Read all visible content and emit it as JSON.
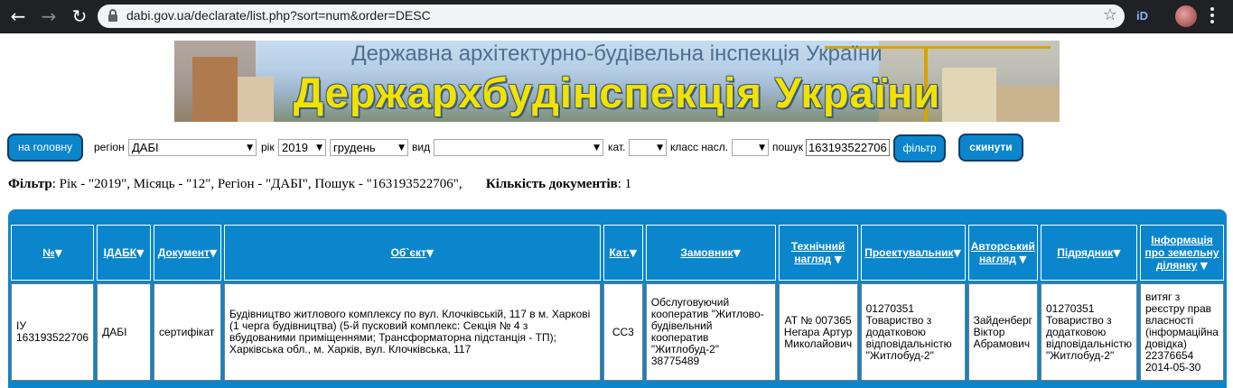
{
  "browser": {
    "url": "dabi.gov.ua/declarate/list.php?sort=num&order=DESC"
  },
  "banner": {
    "subtitle": "Державна архітектурно-будівельна інспекція України",
    "title": "Держархбудінспекція України"
  },
  "filters": {
    "home_button": "на головну",
    "region_label": "регіон",
    "region_value": "ДАБІ",
    "year_label": "рік",
    "year_value": "2019",
    "month_value": "грудень",
    "type_label": "вид",
    "type_value": "",
    "category_label": "кат.",
    "category_value": "",
    "class_label": "класс насл.",
    "class_value": "",
    "search_label": "пошук",
    "search_value": "163193522706",
    "filter_button": "фільтр",
    "reset_button": "скинути"
  },
  "summary": {
    "filter_label": "Фільтр",
    "filter_text": ": Рік - \"2019\", Місяць - \"12\", Регіон - \"ДАБІ\", Пошук - \"163193522706\",",
    "count_label": "Кількість документів",
    "count_value": ": 1"
  },
  "table": {
    "columns": [
      "№",
      "ІДАБК",
      "Документ",
      "Об`єкт",
      "Кат.",
      "Замовник",
      "Технічний нагляд",
      "Проектувальник",
      "Авторський нагляд",
      "Підрядник",
      "Інформація про земельну ділянку"
    ],
    "rows": [
      {
        "num_line1": "ІУ",
        "num_line2": "163193522706",
        "idabk": "ДАБІ",
        "document": "сертифікат",
        "object": "Будівництво житлового комплексу по вул. Клочківській, 117 в м. Харкові (1 черга будівництва) (5-й пусковий комплекс: Секція № 4 з вбудованими приміщеннями; Трансформаторна підстанція - ТП); Харківська обл., м. Харків, вул. Клочківська, 117",
        "category": "СС3",
        "customer": "Обслуговуючий кооператив \"Житлово-будівельний кооператив \"Житлобуд-2\" 38775489",
        "tech_supervision": "АТ № 007365 Негара Артур Миколайович",
        "designer": "01270351 Товариство з додатковою відповідальністю \"Житлобуд-2\"",
        "author_supervision": "Зайденберг Віктор Абрамович",
        "contractor": "01270351 Товариство з додатковою відповідальністю \"Житлобуд-2\"",
        "land_info": "витяг з реєстру прав власності (інформаційна довідка) 22376654 2014-05-30"
      }
    ]
  },
  "colors": {
    "accent": "#0b86cc",
    "button_border": "#0a3d66",
    "banner_title": "#f2e200"
  }
}
